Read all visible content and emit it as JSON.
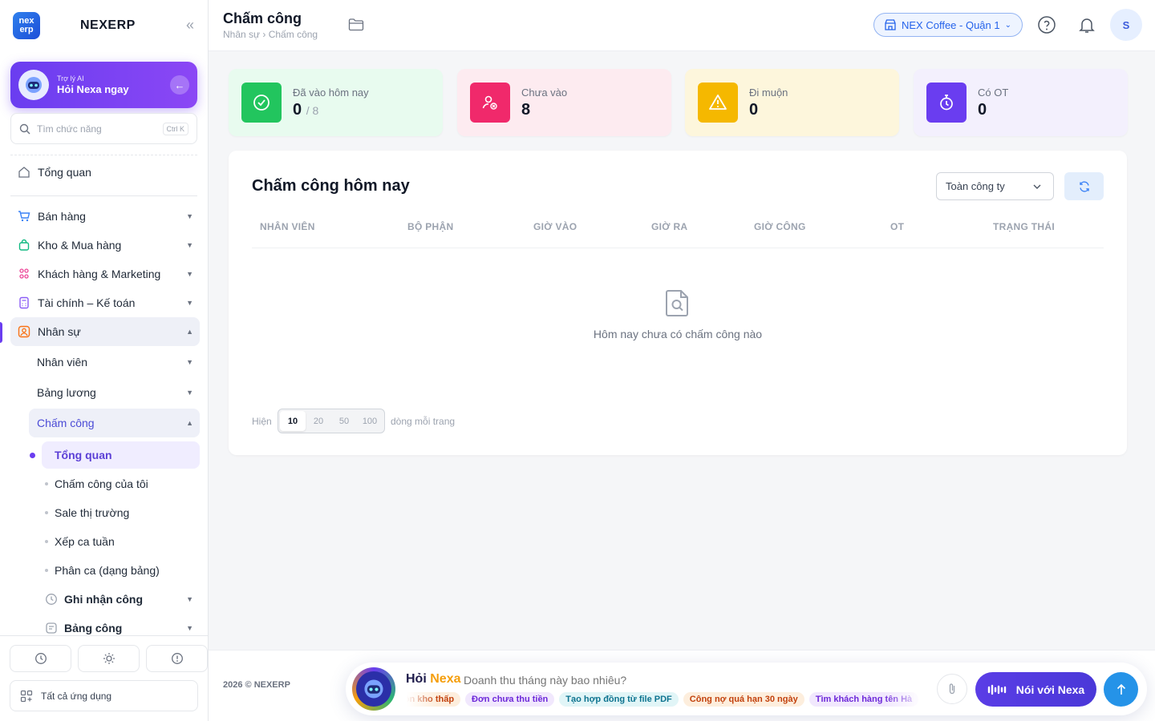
{
  "sidebar": {
    "logo_line1": "nex",
    "logo_line2": "erp",
    "brand": "NEXERP",
    "ai_small": "Trợ lý AI",
    "ai_big": "Hỏi Nexa ngay",
    "search_placeholder": "Tìm chức năng",
    "search_shortcut": "Ctrl K",
    "overview": "Tổng quan",
    "groups": [
      "Bán hàng",
      "Kho & Mua hàng",
      "Khách hàng & Marketing",
      "Tài chính – Kế toán",
      "Nhân sự"
    ],
    "hr_children": [
      "Nhân viên",
      "Bảng lương",
      "Chấm công"
    ],
    "attendance_children": [
      "Tổng quan",
      "Chấm công của tôi",
      "Sale thị trường",
      "Xếp ca tuần",
      "Phân ca (dạng bảng)"
    ],
    "attendance_groups": [
      "Ghi nhận công",
      "Bảng công"
    ],
    "all_apps": "Tất cả ứng dụng"
  },
  "header": {
    "title": "Chấm công",
    "breadcrumb": "Nhân sự › Chấm công",
    "branch": "NEX Coffee - Quận 1",
    "avatar": "S"
  },
  "stats": [
    {
      "label": "Đã vào hôm nay",
      "value": "0",
      "sub": "/ 8",
      "color": "#22c55e",
      "bg": "#e8fbef"
    },
    {
      "label": "Chưa vào",
      "value": "8",
      "sub": "",
      "color": "#f0296b",
      "bg": "#fdebf0"
    },
    {
      "label": "Đi muộn",
      "value": "0",
      "sub": "",
      "color": "#f5b800",
      "bg": "#fdf6dc"
    },
    {
      "label": "Có OT",
      "value": "0",
      "sub": "",
      "color": "#6a3df0",
      "bg": "#f3f0fd"
    }
  ],
  "main": {
    "title": "Chấm công hôm nay",
    "filter_value": "Toàn công ty",
    "columns": [
      "NHÂN VIÊN",
      "BỘ PHẬN",
      "GIỜ VÀO",
      "GIỜ RA",
      "GIỜ CÔNG",
      "OT",
      "TRẠNG THÁI"
    ],
    "empty_text": "Hôm nay chưa có chấm công nào",
    "pager_prefix": "Hiện",
    "pager_options": [
      "10",
      "20",
      "50",
      "100"
    ],
    "pager_selected": "10",
    "pager_suffix": "dòng mỗi trang"
  },
  "footer": {
    "copyright": "2026 © NEXERP",
    "ask_label": "Hỏi",
    "ask_brand": "Nexa",
    "ask_placeholder": "Doanh thu tháng này bao nhiêu?",
    "chips": [
      {
        "text": "Tồn kho thấp",
        "bg": "#fdeedd",
        "color": "#c2410c"
      },
      {
        "text": "Đơn chưa thu tiền",
        "bg": "#f1e8fd",
        "color": "#6d28d9"
      },
      {
        "text": "Tạo hợp đồng từ file PDF",
        "bg": "#e1f5f7",
        "color": "#0e7490"
      },
      {
        "text": "Công nợ quá hạn 30 ngày",
        "bg": "#fdeedd",
        "color": "#c2410c"
      },
      {
        "text": "Tìm khách hàng tên Hà",
        "bg": "#f1e8fd",
        "color": "#6d28d9"
      }
    ],
    "talk_label": "Nói với Nexa"
  },
  "colors": {
    "accent": "#6a3df0",
    "primary": "#2563eb"
  }
}
